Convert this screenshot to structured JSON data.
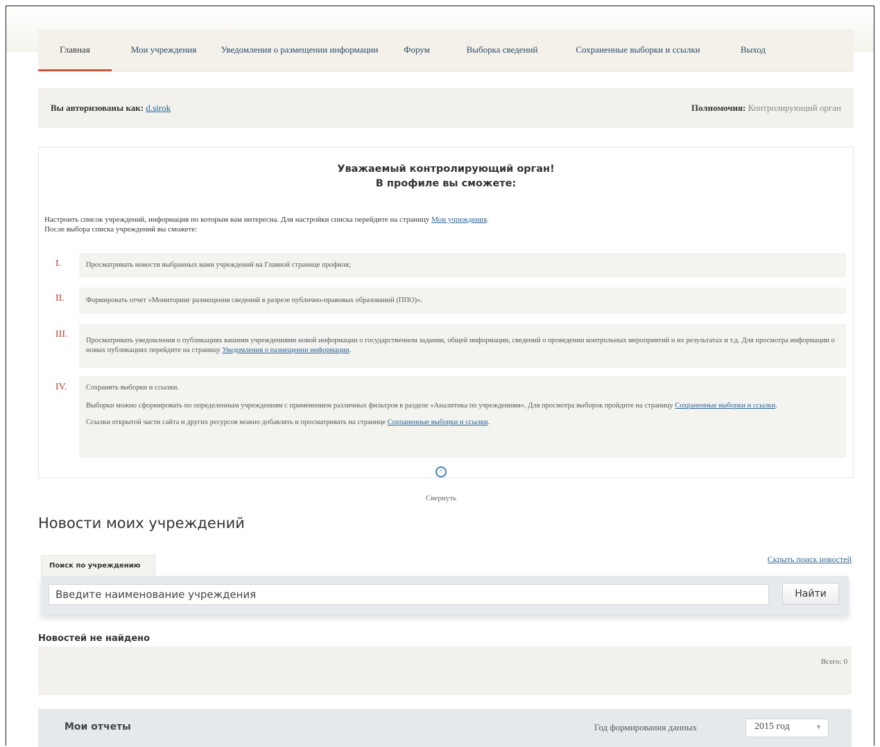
{
  "nav": [
    {
      "label": "Главная"
    },
    {
      "label": "Мои учреждения"
    },
    {
      "label": "Уведомления о размещении информации"
    },
    {
      "label": "Форум"
    },
    {
      "label": "Выборка сведений"
    },
    {
      "label": "Сохраненные выборки и ссылки"
    },
    {
      "label": "Выход"
    }
  ],
  "auth": {
    "prefix": "Вы авторизованы как:",
    "user": "d.sirok",
    "role_label": "Полномочия:",
    "role_value": "Контролирующий орган"
  },
  "profile": {
    "title_line1": "Уважаемый контролирующий орган!",
    "title_line2": "В профиле вы сможете:",
    "intro_text": "Настроить список учреждений, информация по которым вам интересна. Для настройки списка перейдите на страницу",
    "intro_link": "Мои учреждения",
    "intro_after": "После выбора списка учреждений вы сможете:",
    "items": [
      {
        "num": "I.",
        "text": "Просматривать новости выбранных вами учреждений на Главной странице профиля;"
      },
      {
        "num": "II.",
        "text": "Формировать отчет «Мониторинг размещения сведений в разрезе публично-правовых образований (ППО)»."
      },
      {
        "num": "III.",
        "text": "Просматривать уведомления о публикациях вашими учреждениями новой информации о государственном задании, общей информации, сведений о проведении контрольных мероприятий и их результатах и т.д. Для просмотра информации о новых публикациях перейдите на страницу",
        "link": "Уведомления о размещении информации"
      },
      {
        "num": "IV.",
        "text": "Сохранять выборки и ссылки.",
        "p2": "Выборки можно сформировать по определенным учреждениям с применением различных фильтров в разделе «Аналитика по учреждениям». Для просмотра выборок пройдите на страницу",
        "p2_link": "Сохраненные выборки и ссылки",
        "p3": "Ссылки открытой части сайта и других ресурсов можно добавлять и просматривать на странице",
        "p3_link": "Сохраненные выборки и ссылки"
      }
    ],
    "collapse_label": "Свернуть",
    "collapse_icon": "collapse-chevron-icon"
  },
  "news": {
    "heading": "Новости моих учреждений",
    "tab_label": "Поиск по учреждению",
    "hide_link": "Скрыть поиск новостей",
    "search_value": "Введите наименование учреждения",
    "search_button": "Найти",
    "empty_text": "Новостей не найдено",
    "total": "Всего: 0"
  },
  "reports": {
    "title": "Мои отчеты",
    "year_label": "Год формирования данных",
    "year_value": "2015 год"
  },
  "colors": {
    "accent": "#c9543a",
    "link": "#2a6496",
    "roman": "#c0392b"
  }
}
